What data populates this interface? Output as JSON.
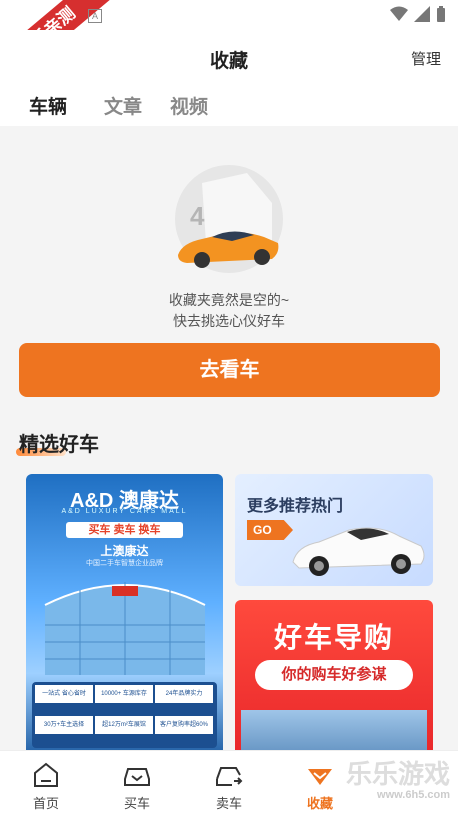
{
  "statusbar": {
    "ribbon_text": "乐乐亲测",
    "badge_text": "A"
  },
  "header": {
    "title": "收藏",
    "manage_label": "管理"
  },
  "tabs": [
    {
      "label": "车辆"
    },
    {
      "label": "文章"
    },
    {
      "label": "视频"
    }
  ],
  "empty_state": {
    "line1": "收藏夹竟然是空的~",
    "line2": "快去挑选心仪好车",
    "cta_label": "去看车"
  },
  "section": {
    "title": "精选好车"
  },
  "cards": {
    "left": {
      "brand_text": "A&D 澳康达",
      "brand_sub": "A&D LUXURY CARS MALL",
      "tagline": "买车 卖车 换车",
      "subtitle": "上澳康达",
      "desc": "中国二手车智慧企业品牌",
      "stats": [
        "一站式 省心省时",
        "10000+ 车源库存",
        "24年品牌实力",
        "30万+车主选择",
        "超12万m²车展馆",
        "客户复购率超60%"
      ]
    },
    "right_top": {
      "title": "更多推荐热门",
      "go_label": "GO"
    },
    "right_bottom": {
      "title": "好车导购",
      "pill": "你的购车好参谋"
    }
  },
  "bottom_nav": [
    {
      "label": "首页"
    },
    {
      "label": "买车"
    },
    {
      "label": "卖车"
    },
    {
      "label": "收藏"
    }
  ],
  "watermark": {
    "main": "乐乐游戏",
    "sub": "www.6h5.com"
  }
}
